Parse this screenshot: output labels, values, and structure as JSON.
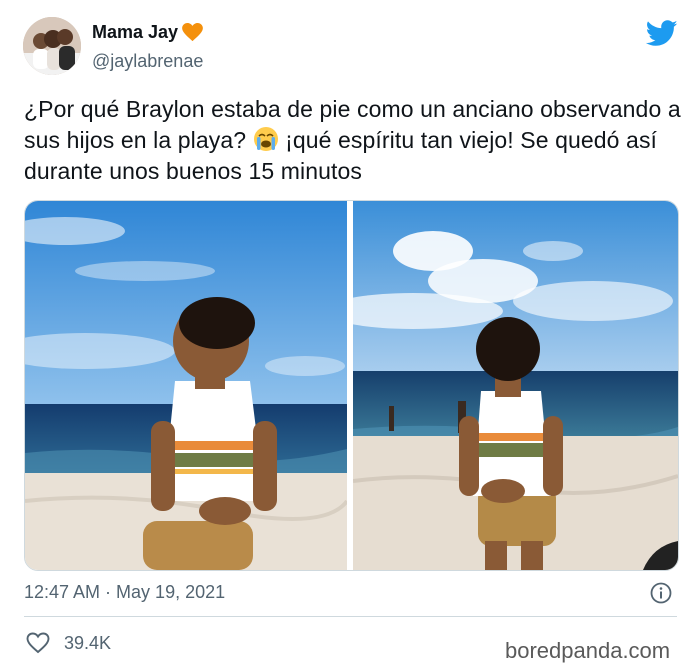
{
  "author": {
    "display_name": "Mama Jay",
    "handle": "@jaylabrenae"
  },
  "icons": {
    "heart": "orange-heart-icon",
    "twitter": "twitter-bird-icon",
    "emoji": "loudly-crying-face-icon",
    "info": "info-icon",
    "like": "like-heart-icon"
  },
  "tweet": {
    "text_before_emoji": "¿Por qué Braylon estaba de pie como un anciano observando a sus hijos en la playa? ",
    "text_after_emoji": " ¡qué espíritu tan viejo! Se quedó así durante unos buenos 15 minutos",
    "timestamp": "12:47 AM · May 19, 2021",
    "like_count": "39.4K"
  },
  "watermark": "boredpanda.com",
  "colors": {
    "twitter_blue": "#1d9bf0",
    "heart_orange": "#f4900c",
    "secondary_text": "#536471"
  }
}
